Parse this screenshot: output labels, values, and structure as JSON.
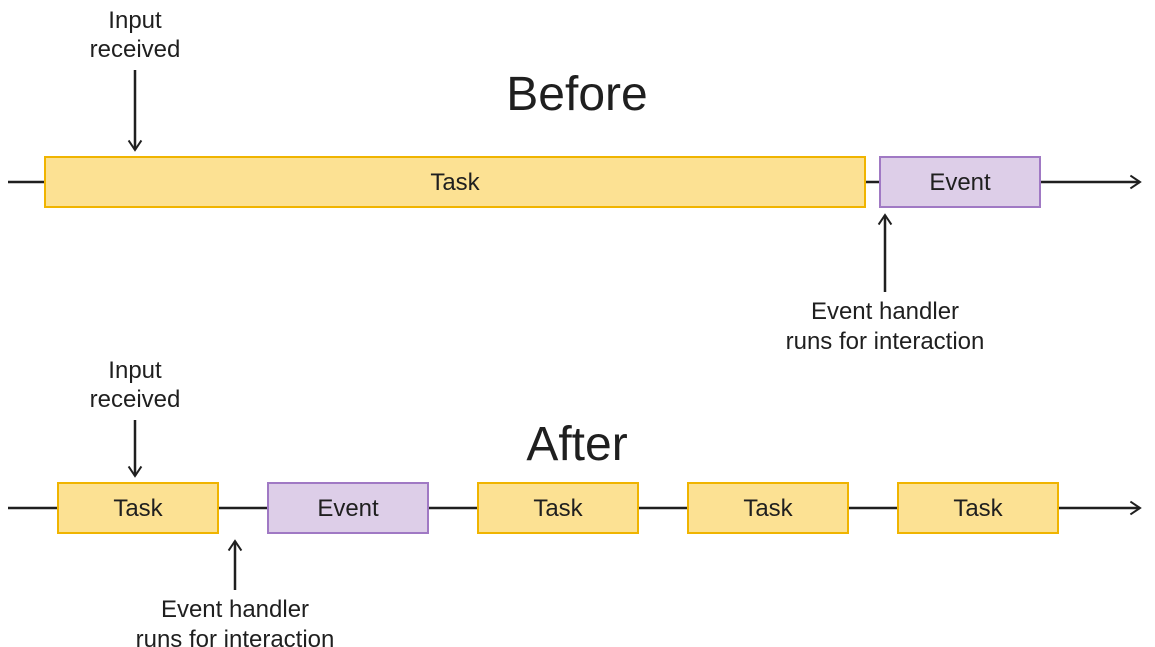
{
  "before": {
    "title": "Before",
    "input_label_1": "Input",
    "input_label_2": "received",
    "handler_label_1": "Event handler",
    "handler_label_2": "runs for interaction",
    "task_label": "Task",
    "event_label": "Event"
  },
  "after": {
    "title": "After",
    "input_label_1": "Input",
    "input_label_2": "received",
    "handler_label_1": "Event handler",
    "handler_label_2": "runs for interaction",
    "task1_label": "Task",
    "event_label": "Event",
    "task2_label": "Task",
    "task3_label": "Task",
    "task4_label": "Task"
  }
}
